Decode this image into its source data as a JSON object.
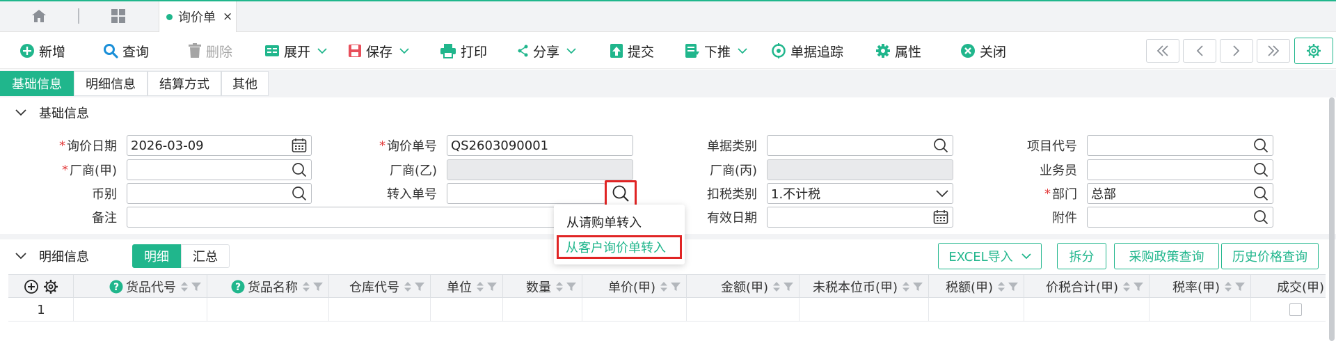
{
  "tabbar": {
    "doc_tab_title": "询价单",
    "close_glyph": "×"
  },
  "toolbar": {
    "new": "新增",
    "query": "查询",
    "delete": "删除",
    "expand": "展开",
    "save": "保存",
    "print": "打印",
    "share": "分享",
    "submit": "提交",
    "push_down": "下推",
    "track": "单据追踪",
    "properties": "属性",
    "close": "关闭"
  },
  "section_tabs": [
    "基础信息",
    "明细信息",
    "结算方式",
    "其他"
  ],
  "basic_section": {
    "title": "基础信息"
  },
  "fields": {
    "inquiry_date": {
      "label": "询价日期",
      "value": "2026-03-09"
    },
    "inquiry_no": {
      "label": "询价单号",
      "value": "QS2603090001"
    },
    "doc_type": {
      "label": "单据类别",
      "value": ""
    },
    "project_code": {
      "label": "项目代号",
      "value": ""
    },
    "vendor_a": {
      "label": "厂商(甲)",
      "value": ""
    },
    "vendor_b": {
      "label": "厂商(乙)",
      "value": ""
    },
    "vendor_c": {
      "label": "厂商(丙)",
      "value": ""
    },
    "salesperson": {
      "label": "业务员",
      "value": ""
    },
    "currency": {
      "label": "币别",
      "value": ""
    },
    "transfer_no": {
      "label": "转入单号",
      "value": ""
    },
    "tax_type": {
      "label": "扣税类别",
      "value": "1.不计税"
    },
    "department": {
      "label": "部门",
      "value": "总部"
    },
    "remark": {
      "label": "备注",
      "value": ""
    },
    "valid_date": {
      "label": "有效日期",
      "value": ""
    },
    "attachment": {
      "label": "附件",
      "value": ""
    }
  },
  "dropdown": {
    "items": [
      "从请购单转入",
      "从客户询价单转入"
    ]
  },
  "detail_section": {
    "title": "明细信息",
    "tabs": [
      "明细",
      "汇总"
    ],
    "buttons": {
      "excel": "EXCEL导入",
      "split": "拆分",
      "policy": "采购政策查询",
      "history": "历史价格查询"
    }
  },
  "grid": {
    "columns": [
      "货品代号",
      "货品名称",
      "仓库代号",
      "单位",
      "数量",
      "单价(甲)",
      "金额(甲)",
      "未税本位币(甲)",
      "税额(甲)",
      "价税合计(甲)",
      "税率(甲)",
      "成交(甲)"
    ],
    "rows": [
      {
        "num": "1"
      }
    ]
  },
  "colors": {
    "accent": "#20b68c",
    "highlight": "#e02424",
    "required": "#e33b3b"
  }
}
